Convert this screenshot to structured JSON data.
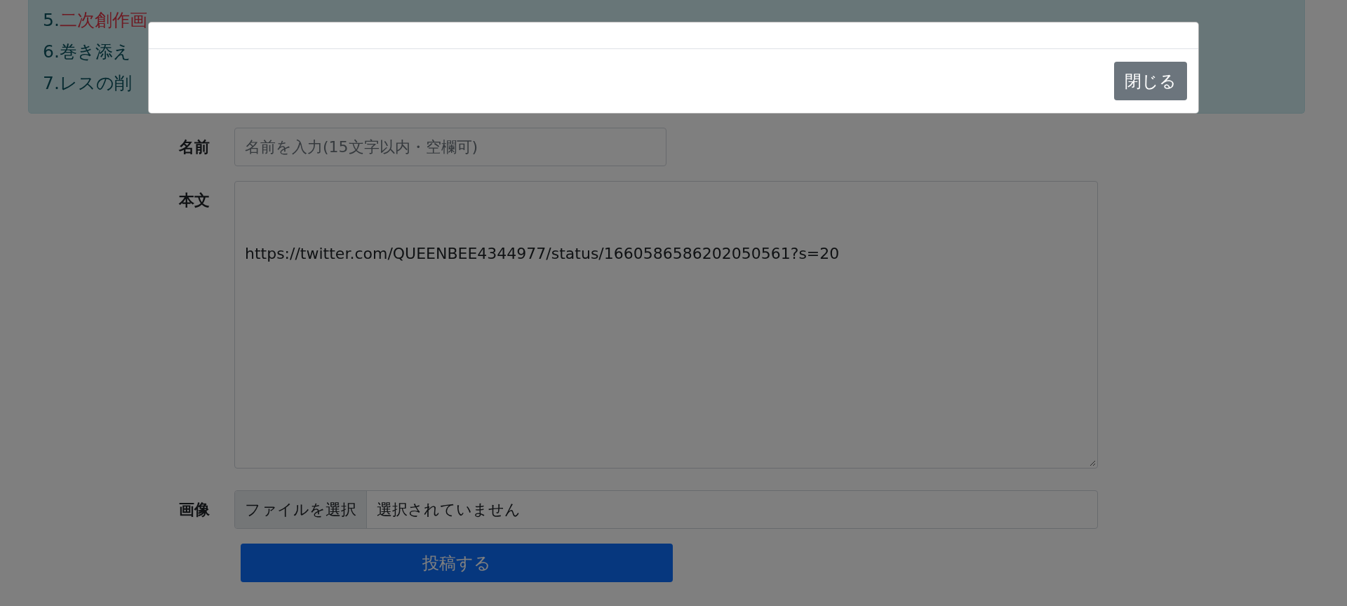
{
  "notice": {
    "lines": [
      {
        "number": "5.",
        "text": "二次創作画",
        "kind": "warning"
      },
      {
        "number": "6.",
        "text": "巻き添え",
        "kind": "plain"
      },
      {
        "number": "7.",
        "text": "レスの削",
        "kind": "plain"
      }
    ]
  },
  "modal": {
    "buttons": [
      {
        "label": "閉じる"
      }
    ]
  },
  "form": {
    "name": {
      "label": "名前",
      "placeholder": "名前を入力(15文字以内・空欄可)"
    },
    "body": {
      "label": "本文",
      "value": "https://twitter.com/QUEENBEE4344977/status/1660586586202050561?s=20"
    },
    "image": {
      "label": "画像",
      "button": "ファイルを選択",
      "status": "選択されていません"
    },
    "submit": {
      "label": "投稿する"
    }
  }
}
